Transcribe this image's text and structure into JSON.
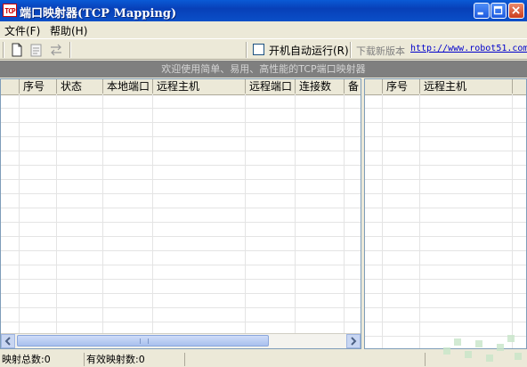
{
  "window": {
    "title": "端口映射器(TCP Mapping)",
    "app_icon_text": "TCP",
    "controls": [
      "minimize-icon",
      "maximize-icon",
      "close-icon"
    ]
  },
  "menu": {
    "items": [
      {
        "label": "文件(F)"
      },
      {
        "label": "帮助(H)"
      }
    ]
  },
  "toolbar": {
    "buttons": [
      "new-document-icon",
      "properties-icon",
      "mapping-icon"
    ],
    "autorun_label": "开机自动运行(R)",
    "autorun_checked": false,
    "download_label": "下载新版本",
    "download_url": "http://www.robot51.com"
  },
  "banner": {
    "text": "欢迎使用简单、易用、高性能的TCP端口映射器"
  },
  "mapping_table": {
    "columns": [
      "",
      "序号",
      "状态",
      "本地端口",
      "远程主机",
      "远程端口",
      "连接数",
      "备"
    ],
    "rows": []
  },
  "connection_table": {
    "columns": [
      "",
      "序号",
      "远程主机"
    ],
    "rows": []
  },
  "status": {
    "total_mappings": "映射总数:0",
    "active_mappings": "有效映射数:0"
  },
  "colors": {
    "title_bar": "#0a4fc8",
    "banner_bg": "#7f7f7f",
    "link": "#0000cc",
    "window_bg": "#ece9d8"
  }
}
